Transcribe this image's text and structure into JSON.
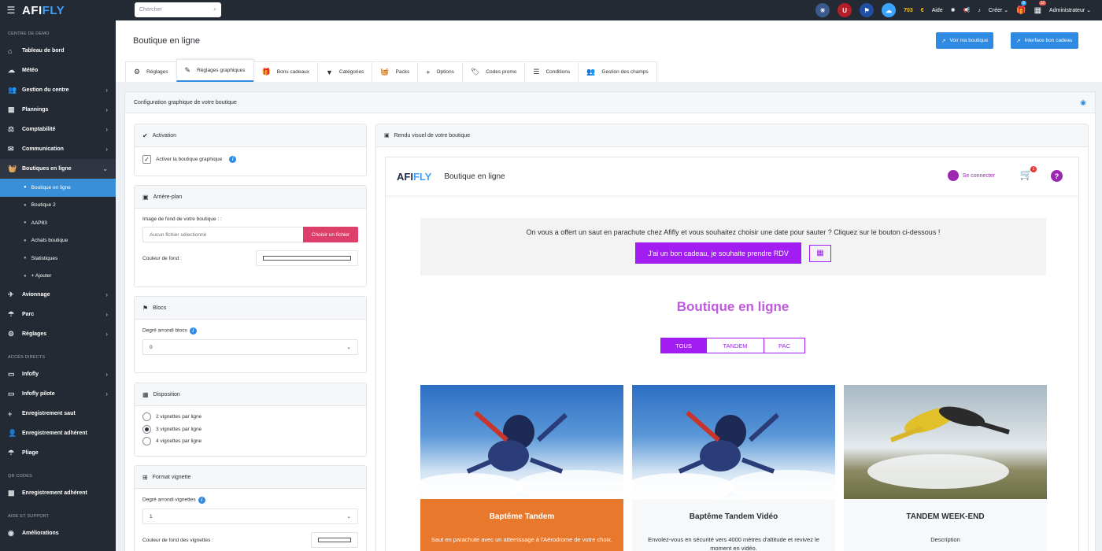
{
  "topbar": {
    "logo": "AFIFLY",
    "search_placeholder": "Chercher",
    "credits": "703",
    "help": "Aide",
    "create": "Créer",
    "user": "Administrateur",
    "badges": {
      "gift": "9",
      "calendar": "12"
    }
  },
  "sidebar": {
    "section_demo": "CENTRE DE DEMO",
    "items_top": [
      {
        "label": "Tableau de bord",
        "icon": "home-icon"
      },
      {
        "label": "Météo",
        "icon": "cloud-icon"
      },
      {
        "label": "Gestion du centre",
        "icon": "users-icon"
      },
      {
        "label": "Plannings",
        "icon": "calendar-icon"
      },
      {
        "label": "Comptabilité",
        "icon": "scale-icon"
      },
      {
        "label": "Communication",
        "icon": "mail-icon"
      },
      {
        "label": "Boutiques en ligne",
        "icon": "shop-icon"
      }
    ],
    "sub_items": [
      "Boutique en ligne",
      "Boutique 2",
      "AAP83",
      "Achats boutique",
      "Statistiques",
      "+ Ajouter"
    ],
    "items_bottom": [
      {
        "label": "Avionnage",
        "icon": "plane-icon"
      },
      {
        "label": "Parc",
        "icon": "parachute-icon"
      },
      {
        "label": "Réglages",
        "icon": "gear-icon"
      }
    ],
    "section_direct": "ACCÈS DIRECTS",
    "items_direct": [
      {
        "label": "Infofly",
        "icon": "laptop-icon"
      },
      {
        "label": "Infofly pilote",
        "icon": "laptop-icon"
      },
      {
        "label": "Enregistrement saut",
        "icon": "plus-icon"
      },
      {
        "label": "Enregistrement adhérent",
        "icon": "user-plus-icon"
      },
      {
        "label": "Pliage",
        "icon": "parachute-icon"
      }
    ],
    "section_qr": "QR CODES",
    "items_qr": [
      {
        "label": "Enregistrement adhérent",
        "icon": "qr-icon"
      }
    ],
    "section_help": "AIDE ET SUPPORT",
    "items_help": [
      {
        "label": "Améliorations",
        "icon": "github-icon"
      }
    ]
  },
  "header": {
    "title": "Boutique en ligne",
    "btn_shop": "Voir ma boutique",
    "btn_interface": "Interface bon cadeau"
  },
  "tabs": [
    {
      "label": "Réglages",
      "icon": "⚙"
    },
    {
      "label": "Réglages graphiques",
      "icon": "✎"
    },
    {
      "label": "Bons cadeaux",
      "icon": "🎁"
    },
    {
      "label": "Catégories",
      "icon": "▼"
    },
    {
      "label": "Packs",
      "icon": "🧺"
    },
    {
      "label": "Options",
      "icon": "+"
    },
    {
      "label": "Codes promo",
      "icon": "🏷"
    },
    {
      "label": "Conditions",
      "icon": "☰"
    },
    {
      "label": "Gestion des champs",
      "icon": "👥"
    }
  ],
  "config": {
    "title": "Configuration graphique de votre boutique",
    "activation": {
      "title": "Activation",
      "checkbox": "Activer la boutique graphique"
    },
    "background": {
      "title": "Arrière-plan",
      "image_label": "Image de fond de votre boutique : :",
      "file_placeholder": "Aucun fichier sélectionné",
      "file_button": "Choisir un fichier",
      "color_label": "Couleur de fond :"
    },
    "blocks": {
      "title": "Blocs",
      "radius_label": "Degré arrondi blocs",
      "radius_value": "0"
    },
    "layout": {
      "title": "Disposition",
      "options": [
        "2 vignettes par ligne",
        "3 vignettes par ligne",
        "4 vignettes par ligne"
      ],
      "selected": 1
    },
    "thumb": {
      "title": "Format vignette",
      "radius_label": "Degré arrondi vignettes",
      "radius_value": "1",
      "bg_label": "Couleur de fond des vignettes :"
    }
  },
  "preview": {
    "title": "Rendu visuel de votre boutique",
    "shop_logo": "AFIFLY",
    "shop_title": "Boutique en ligne",
    "login": "Se connecter",
    "cart_count": "1",
    "gift_text": "On vous a offert un saut en parachute chez Afifly et vous souhaitez choisir une date pour sauter ? Cliquez sur le bouton ci-dessous !",
    "gift_button": "J'ai un bon cadeau, je souhaite prendre RDV",
    "heading": "Boutique en ligne",
    "filters": [
      "TOUS",
      "TANDEM",
      "PAC"
    ],
    "products": [
      {
        "name": "Baptême Tandem",
        "desc": "Saut en parachute avec un atterrissage à l'Aérodrome de votre choix."
      },
      {
        "name": "Baptême Tandem Vidéo",
        "desc": "Envolez-vous en sécurité vers 4000 mètres d'altitude et revivez le moment en vidéo."
      },
      {
        "name": "TANDEM WEEK-END",
        "desc": "Description"
      }
    ]
  },
  "colors": {
    "accent": "#a11df2",
    "primary": "#2f8ae2",
    "sidebar": "#242a33",
    "danger": "#dd3f6a",
    "card_orange": "#e8782c"
  }
}
